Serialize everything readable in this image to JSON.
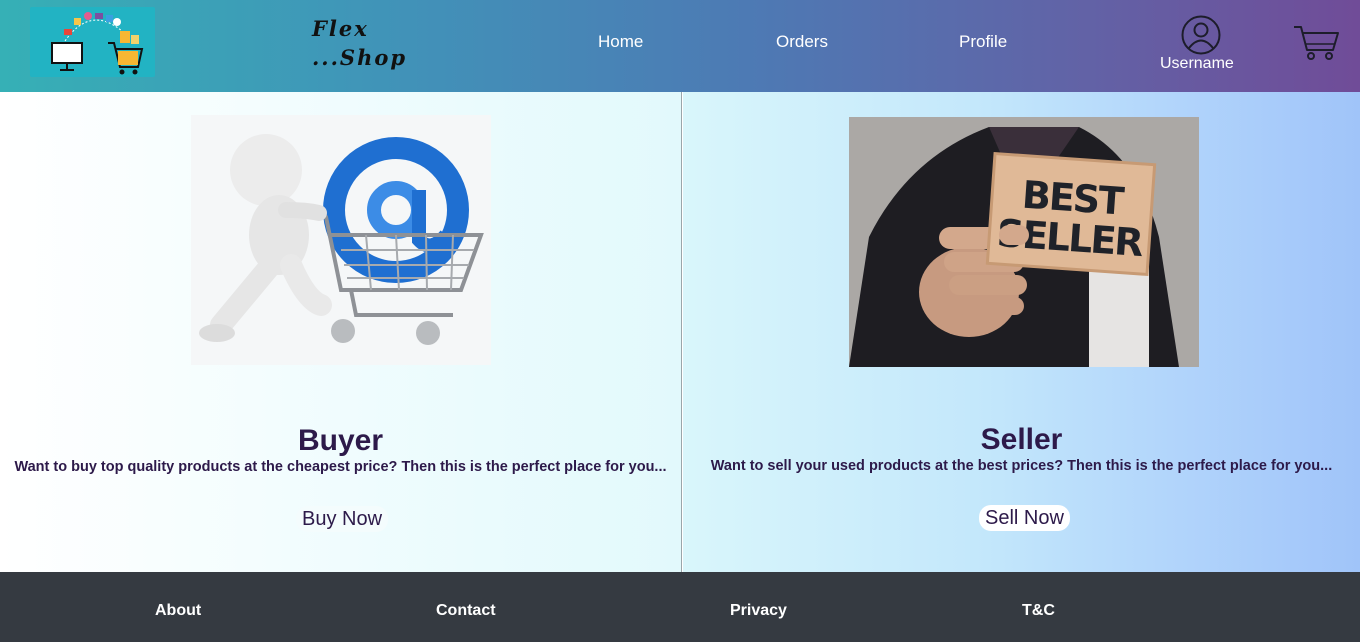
{
  "header": {
    "brand_line1": "Flex",
    "brand_line2": "...Shop",
    "logo_icon": "shopping-logo-icon",
    "nav": [
      {
        "label": "Home"
      },
      {
        "label": "Orders"
      },
      {
        "label": "Profile"
      }
    ],
    "user": {
      "label": "Username",
      "icon": "user-avatar-icon"
    },
    "cart_icon": "shopping-cart-icon"
  },
  "buyer": {
    "title": "Buyer",
    "description": "Want to buy top quality products at the cheapest price? Then this is the perfect place for you...",
    "button_label": "Buy Now"
  },
  "seller": {
    "title": "Seller",
    "description": "Want to sell your used products at the best prices? Then this is the perfect place for you...",
    "button_label": "Sell Now",
    "sign_line1": "BEST",
    "sign_line2": "SELLER"
  },
  "footer": {
    "links": [
      {
        "label": "About"
      },
      {
        "label": "Contact"
      },
      {
        "label": "Privacy"
      },
      {
        "label": "T&C"
      }
    ]
  },
  "colors": {
    "header_start": "#36b0b6",
    "header_end": "#704c98",
    "title_text": "#2d1a4a",
    "footer_bg": "#353a41"
  }
}
